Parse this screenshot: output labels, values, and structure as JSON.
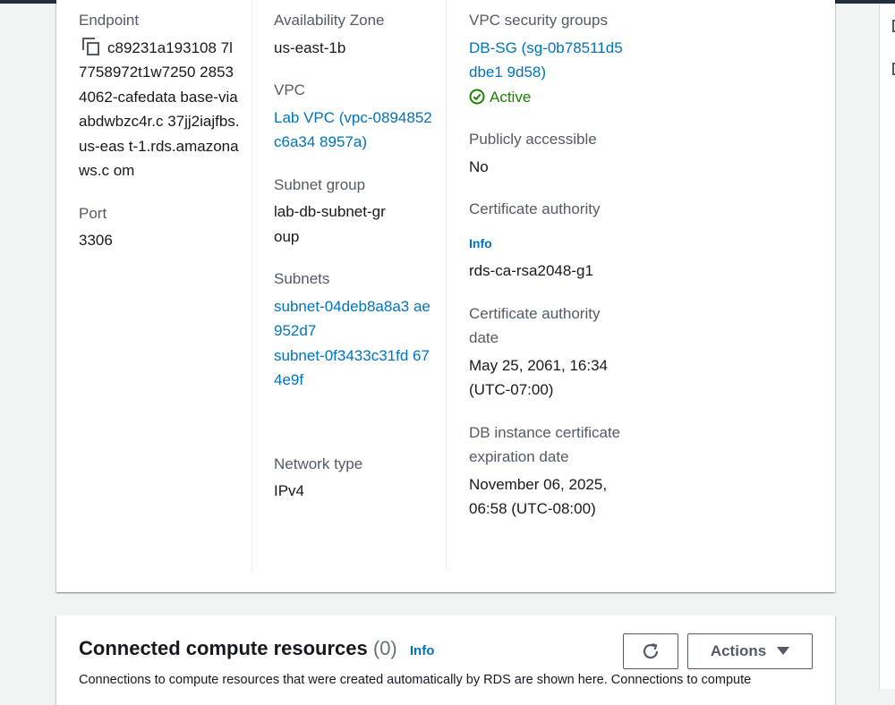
{
  "connectivity": {
    "endpoint": {
      "label": "Endpoint",
      "value": "c89231a193108 7l7758972t1w7250 28534062-cafedata base-viaabdwbzc4r.c 37jj2iajfbs.us-eas t-1.rds.amazonaws.c om"
    },
    "port": {
      "label": "Port",
      "value": "3306"
    },
    "availability_zone": {
      "label": "Availability Zone",
      "value": "us-east-1b"
    },
    "vpc": {
      "label": "VPC",
      "value": "Lab VPC (vpc-0894852c6a34 8957a)"
    },
    "subnet_group": {
      "label": "Subnet group",
      "value": "lab-db-subnet-group"
    },
    "subnets": {
      "label": "Subnets",
      "items": [
        "subnet-04deb8a8a3 ae952d7",
        "subnet-0f3433c31fd 674e9f"
      ]
    },
    "network_type": {
      "label": "Network type",
      "value": "IPv4"
    },
    "security_groups": {
      "label": "VPC security groups",
      "group": "DB-SG (sg-0b78511d5dbe1 9d58)",
      "status": "Active",
      "status_color": "#1d8102"
    },
    "publicly_accessible": {
      "label": "Publicly accessible",
      "value": "No"
    },
    "certificate_authority": {
      "label": "Certificate authority",
      "info": "Info",
      "value": "rds-ca-rsa2048-g1"
    },
    "ca_date": {
      "label": "Certificate authority date",
      "value": "May 25, 2061, 16:34 (UTC-07:00)"
    },
    "cert_expiration": {
      "label": "DB instance certificate expiration date",
      "value": "November 06, 2025, 06:58 (UTC-08:00)"
    }
  },
  "compute": {
    "title": "Connected compute resources",
    "count": "(0)",
    "info": "Info",
    "actions_label": "Actions",
    "description": "Connections to compute resources that were created automatically by RDS are shown here. Connections to compute"
  },
  "colors": {
    "link": "#0073bb",
    "success": "#1d8102",
    "header": "#232f3e"
  }
}
